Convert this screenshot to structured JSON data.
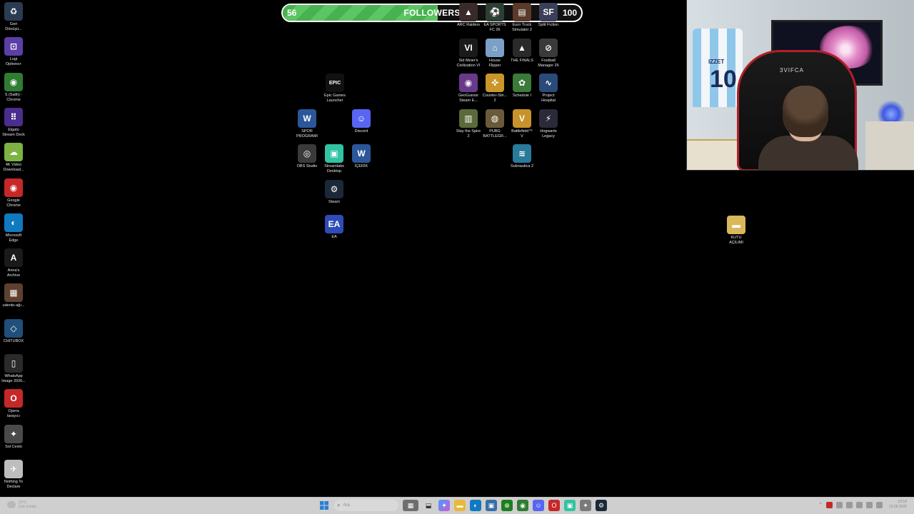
{
  "followers_bar": {
    "current": "56",
    "title": "FOLLOWERS",
    "goal": "100",
    "progress_fraction": 0.52,
    "color": "#47b24f"
  },
  "left_column": [
    {
      "label": "Geri\nDönüşü...",
      "icon": "recycle-bin-icon",
      "color": "#2b3b52",
      "glyph": "♻"
    },
    {
      "label": "Logi\nOptions+",
      "icon": "logi-options-icon",
      "color": "#5b3fa6",
      "glyph": "⊡"
    },
    {
      "label": "S (Salih) -\nChrome",
      "icon": "chrome-icon",
      "color": "#2e7d32",
      "glyph": "◉"
    },
    {
      "label": "Elgato\nStream Deck",
      "icon": "stream-deck-icon",
      "color": "#4a2d8c",
      "glyph": "⠿"
    },
    {
      "label": "4K Video\nDownload...",
      "icon": "4k-downloader-icon",
      "color": "#7cb342",
      "glyph": "☁"
    },
    {
      "label": "Google\nChrome",
      "icon": "chrome-icon",
      "color": "#c62828",
      "glyph": "◉"
    },
    {
      "label": "Microsoft\nEdge",
      "icon": "edge-icon",
      "color": "#0f7ac0",
      "glyph": "◐"
    },
    {
      "label": "Anna's\nArchive",
      "icon": "annas-archive-icon",
      "color": "#1a1a1a",
      "glyph": "A"
    },
    {
      "label": "udento-ağı...",
      "icon": "image-file-icon",
      "color": "#5d4030",
      "glyph": "▦"
    },
    {
      "label": "CHITUBOX",
      "icon": "chitubox-icon",
      "color": "#1f4f7a",
      "glyph": "◇"
    },
    {
      "label": "WhatsApp\nImage 2026...",
      "icon": "image-file-icon",
      "color": "#2a2a2a",
      "glyph": "▯"
    },
    {
      "label": "Opera\ntarayıcı",
      "icon": "opera-icon",
      "color": "#c62828",
      "glyph": "O"
    },
    {
      "label": "Sol Cesto",
      "icon": "game-icon",
      "color": "#4a4a4a",
      "glyph": "✦"
    },
    {
      "label": "Nothing To\nDeclare",
      "icon": "game-icon",
      "color": "#bdbdbd",
      "glyph": "✈"
    }
  ],
  "middle_icons": [
    {
      "label": "Epic Games\nLauncher",
      "icon": "epic-games-icon",
      "color": "#111111",
      "glyph": "EPIC"
    },
    {
      "label": "SPOR\nPROGRAMI",
      "icon": "word-document-icon",
      "color": "#2b579a",
      "glyph": "W"
    },
    {
      "label": "Discord",
      "icon": "discord-icon",
      "color": "#5865f2",
      "glyph": "☺"
    },
    {
      "label": "OBS Studio",
      "icon": "obs-icon",
      "color": "#3a3a3a",
      "glyph": "◎"
    },
    {
      "label": "Streamlabs\nDesktop",
      "icon": "streamlabs-icon",
      "color": "#31c3a2",
      "glyph": "▣"
    },
    {
      "label": "İÇERİK",
      "icon": "word-document-icon",
      "color": "#2b579a",
      "glyph": "W"
    },
    {
      "label": "Steam",
      "icon": "steam-icon",
      "color": "#1b2838",
      "glyph": "⚙"
    },
    {
      "label": "EA",
      "icon": "ea-icon",
      "color": "#2f4bb8",
      "glyph": "EA"
    }
  ],
  "games_grid": [
    {
      "label": "ARC Raiders",
      "icon": "game-icon",
      "color": "#3a2a2a",
      "glyph": "▲"
    },
    {
      "label": "EA SPORTS\nFC 26",
      "icon": "game-icon",
      "color": "#2c3f33",
      "glyph": "⚽"
    },
    {
      "label": "Euro Truck\nSimulator 2",
      "icon": "game-icon",
      "color": "#5a3a2a",
      "glyph": "▤"
    },
    {
      "label": "Split Fiction",
      "icon": "game-icon",
      "color": "#3a3f5a",
      "glyph": "SF"
    },
    {
      "label": "Sid Meier's\nCivilization VI",
      "icon": "game-icon",
      "color": "#1a1a1a",
      "glyph": "VI"
    },
    {
      "label": "House\nFlipper",
      "icon": "game-icon",
      "color": "#7aa0c8",
      "glyph": "⌂"
    },
    {
      "label": "THE FINALS",
      "icon": "game-icon",
      "color": "#2a2a2a",
      "glyph": "▲"
    },
    {
      "label": "Football\nManager 26",
      "icon": "game-icon",
      "color": "#3a3a3a",
      "glyph": "⊘"
    },
    {
      "label": "GeoGuessr\nSteam E...",
      "icon": "game-icon",
      "color": "#6a3a8a",
      "glyph": "◉"
    },
    {
      "label": "Counter-Stri...\n2",
      "icon": "game-icon",
      "color": "#c8962a",
      "glyph": "✜"
    },
    {
      "label": "Schedule I",
      "icon": "game-icon",
      "color": "#3a7a3a",
      "glyph": "✿"
    },
    {
      "label": "Project\nHospital",
      "icon": "game-icon",
      "color": "#2a4a7a",
      "glyph": "∿"
    },
    {
      "label": "Slay the Spire\n2",
      "icon": "game-icon",
      "color": "#5a6a3a",
      "glyph": "▥"
    },
    {
      "label": "PUBG\nBATTLEGR...",
      "icon": "game-icon",
      "color": "#6a5a3a",
      "glyph": "◍"
    },
    {
      "label": "Battlefield™\nV",
      "icon": "game-icon",
      "color": "#c8932a",
      "glyph": "V"
    },
    {
      "label": "Hogwarts\nLegacy",
      "icon": "game-icon",
      "color": "#2a2a3a",
      "glyph": "⚡"
    },
    {
      "label": "Subnautica 2",
      "icon": "game-icon",
      "color": "#2a7a9a",
      "glyph": "≋"
    }
  ],
  "right_icon": {
    "label": "KUTU\nAÇILIMI",
    "icon": "folder-icon",
    "color": "#d8b85a",
    "glyph": "▬"
  },
  "webcam": {
    "chair_brand": "3VIFCA",
    "jersey_number": "10",
    "jersey_name": "IZZET"
  },
  "taskbar": {
    "weather_temp": "23°C",
    "weather_desc": "Çok bulutlu",
    "search_placeholder": "Ara",
    "clock_time": "23:18",
    "clock_date": "13.06.2026"
  }
}
